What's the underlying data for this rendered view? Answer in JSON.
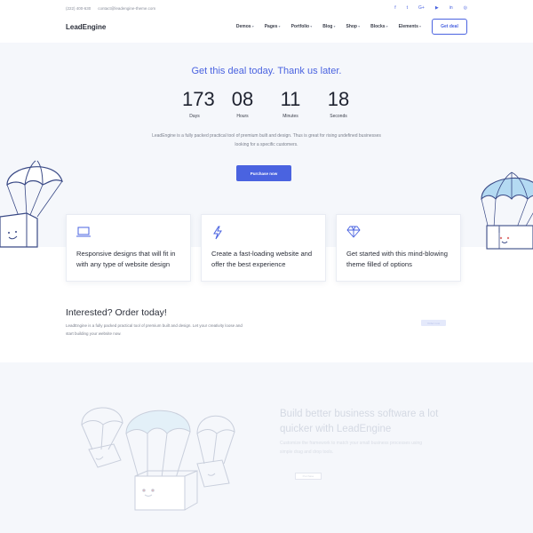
{
  "topbar": {
    "phone": "(222) 400-630",
    "email": "contact@leadengine-theme.com",
    "socials": [
      {
        "icon": "facebook-icon",
        "glyph": "f"
      },
      {
        "icon": "twitter-icon",
        "glyph": "t"
      },
      {
        "icon": "google-plus-icon",
        "glyph": "G+"
      },
      {
        "icon": "youtube-icon",
        "glyph": "▶"
      },
      {
        "icon": "linkedin-icon",
        "glyph": "in"
      },
      {
        "icon": "instagram-icon",
        "glyph": "◎"
      }
    ]
  },
  "header": {
    "logo": "LeadEngine",
    "nav": [
      "Demos",
      "Pages",
      "Portfolio",
      "Blog",
      "Shop",
      "Blocks",
      "Elements"
    ],
    "cta": "Get deal"
  },
  "hero": {
    "title": "Get this deal today. Thank us later.",
    "countdown": [
      {
        "value": "173",
        "label": "Days"
      },
      {
        "value": "08",
        "label": "Hours"
      },
      {
        "value": "11",
        "label": "Minutes"
      },
      {
        "value": "18",
        "label": "Seconds"
      }
    ],
    "text": "LeadEngine is a fully packed practical tool of premium built and design. Thus is great for rising undefined businesses looking for a specific customers.",
    "button": "Purchase now"
  },
  "features": [
    {
      "icon": "laptop-icon",
      "text": "Responsive designs that will fit in with any type of website design"
    },
    {
      "icon": "lightning-icon",
      "text": "Create a fast-loading website and offer the best experience"
    },
    {
      "icon": "diamond-icon",
      "text": "Get started with this mind-blowing theme filled of options"
    }
  ],
  "interested": {
    "title": "Interested? Order today!",
    "text": "LeadEngine is a fully packed practical tool of premium built and design. Let your creativity loose and start building your website now.",
    "button": "Order now"
  },
  "bottom": {
    "title": "Build better business software a lot quicker with LeadEngine",
    "text": "Customize the framework to match your small business processes using simple drag and drop tools.",
    "button": "Purchase"
  },
  "colors": {
    "accent": "#4a63e0",
    "hero_bg": "#f5f7fb",
    "parachute_blue": "#a9d4ef"
  }
}
